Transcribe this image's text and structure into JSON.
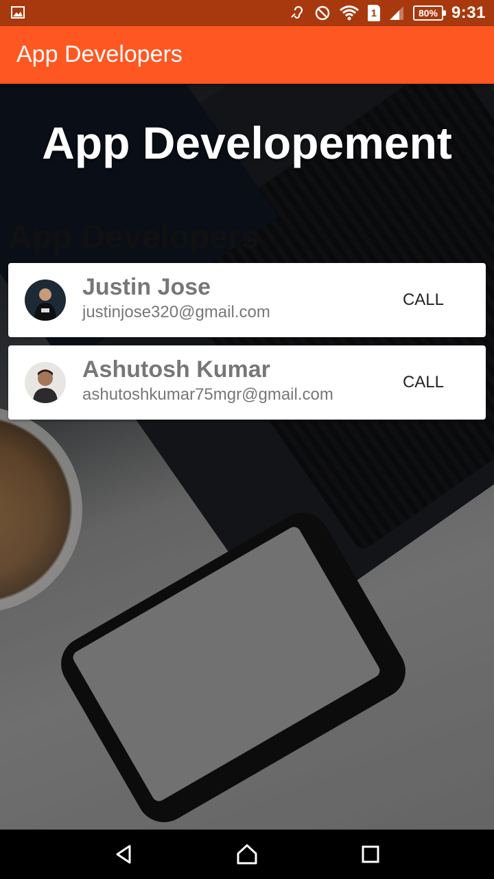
{
  "status_bar": {
    "time": "9:31",
    "battery": "80%",
    "sim_slot": "1",
    "icons": [
      "image-icon",
      "hearing-aid-icon",
      "do-not-disturb-icon",
      "wifi-icon",
      "sim-icon",
      "signal-icon",
      "battery-icon"
    ]
  },
  "app_bar": {
    "title": "App Developers"
  },
  "content": {
    "headline": "App Developement",
    "subheading": "App Developers"
  },
  "developers": [
    {
      "name": "Justin Jose",
      "email": "justinjose320@gmail.com",
      "action": "CALL"
    },
    {
      "name": "Ashutosh Kumar",
      "email": "ashutoshkumar75mgr@gmail.com",
      "action": "CALL"
    }
  ],
  "nav_bar": {
    "icons": [
      "back-icon",
      "home-icon",
      "recents-icon"
    ]
  },
  "colors": {
    "status_bar": "#a8390e",
    "app_bar": "#ff5722",
    "card": "#ffffff",
    "text_secondary": "#777777"
  }
}
